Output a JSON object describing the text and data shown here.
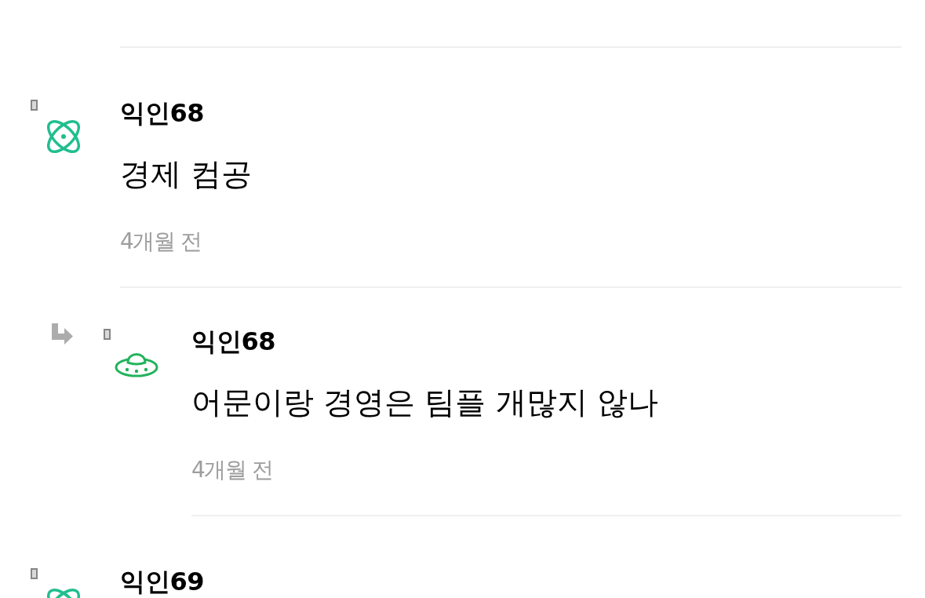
{
  "comments": [
    {
      "kind": "comment",
      "avatar": {
        "kind": "atom"
      },
      "username": "익인68",
      "text": "경제 컴공",
      "time": "4개월 전"
    },
    {
      "kind": "reply",
      "avatar": {
        "kind": "ufo"
      },
      "username": "익인68",
      "text": "어문이랑 경영은 팀플 개많지 않나",
      "time": "4개월 전"
    },
    {
      "kind": "comment",
      "avatar": {
        "kind": "atom"
      },
      "username": "익인69"
    }
  ]
}
